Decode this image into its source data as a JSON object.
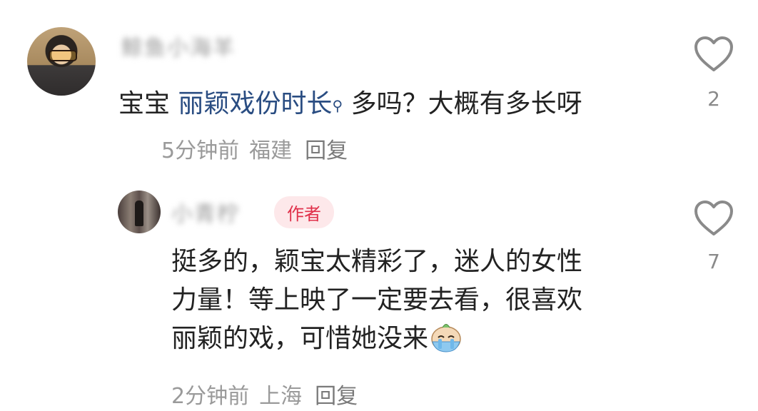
{
  "comment1": {
    "username": "鲸鱼小海羊",
    "text_before": "宝宝 ",
    "link_text": "丽颖戏份时长",
    "search_mark": "⚲",
    "text_after": " 多吗？大概有多长呀",
    "time": "5分钟前",
    "location": "福建",
    "reply_label": "回复",
    "like_count": "2"
  },
  "comment2": {
    "username": "小青柠",
    "badge": "作者",
    "text_line1": "挺多的，颖宝太精彩了，迷人的女性",
    "text_line2": "力量！等上映了一定要去看，很喜欢",
    "text_line3": "丽颖的戏，可惜她没来",
    "emoji": "crying-face-emoji",
    "time": "2分钟前",
    "location": "上海",
    "reply_label": "回复",
    "like_count": "7"
  },
  "colors": {
    "link": "#2a4d82",
    "badge_bg": "#fde8ea",
    "badge_text": "#e0304a",
    "meta": "#9a9a9a"
  }
}
